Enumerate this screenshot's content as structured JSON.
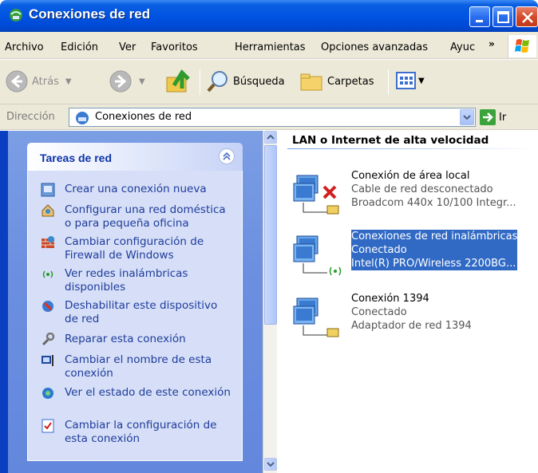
{
  "window": {
    "title": "Conexiones de red",
    "title_icon": "network-connections-icon"
  },
  "menu": {
    "items": [
      "Archivo",
      "Edición",
      "Ver",
      "Favoritos",
      "Herramientas",
      "Opciones avanzadas",
      "Ayuc"
    ],
    "overflow": "»"
  },
  "toolbar": {
    "back_label": "Atrás",
    "search_label": "Búsqueda",
    "folders_label": "Carpetas"
  },
  "address": {
    "label": "Dirección",
    "value": "Conexiones de red",
    "go_label": "Ir"
  },
  "tasks": {
    "header": "Tareas de red",
    "items": [
      {
        "label": "Crear una conexión nueva",
        "icon": "new-connection-icon"
      },
      {
        "label": "Configurar una red doméstica o para pequeña oficina",
        "icon": "home-network-icon"
      },
      {
        "label": "Cambiar configuración de Firewall de Windows",
        "icon": "firewall-icon"
      },
      {
        "label": "Ver redes inalámbricas disponibles",
        "icon": "wireless-icon"
      },
      {
        "label": "Deshabilitar este dispositivo de red",
        "icon": "disable-device-icon"
      },
      {
        "label": "Reparar esta conexión",
        "icon": "repair-icon"
      },
      {
        "label": "Cambiar el nombre de esta conexión",
        "icon": "rename-icon"
      },
      {
        "label": "Ver el estado de este conexión",
        "icon": "status-icon"
      },
      {
        "label": "Cambiar la configuración de esta conexión",
        "icon": "properties-icon"
      }
    ]
  },
  "content": {
    "group_title": "LAN o Internet de alta velocidad",
    "connections": [
      {
        "name": "Conexión de área local",
        "status": "Cable de red desconectado",
        "device": "Broadcom 440x 10/100 Integr...",
        "selected": false
      },
      {
        "name": "Conexiones de red inalámbricas",
        "status": "Conectado",
        "device": "Intel(R) PRO/Wireless 2200BG...",
        "selected": true
      },
      {
        "name": "Conexión 1394",
        "status": "Conectado",
        "device": "Adaptador de red 1394",
        "selected": false
      }
    ]
  },
  "colors": {
    "titlebar": "#0054e3",
    "task_link": "#1f3b9b",
    "selection": "#316ac5"
  }
}
